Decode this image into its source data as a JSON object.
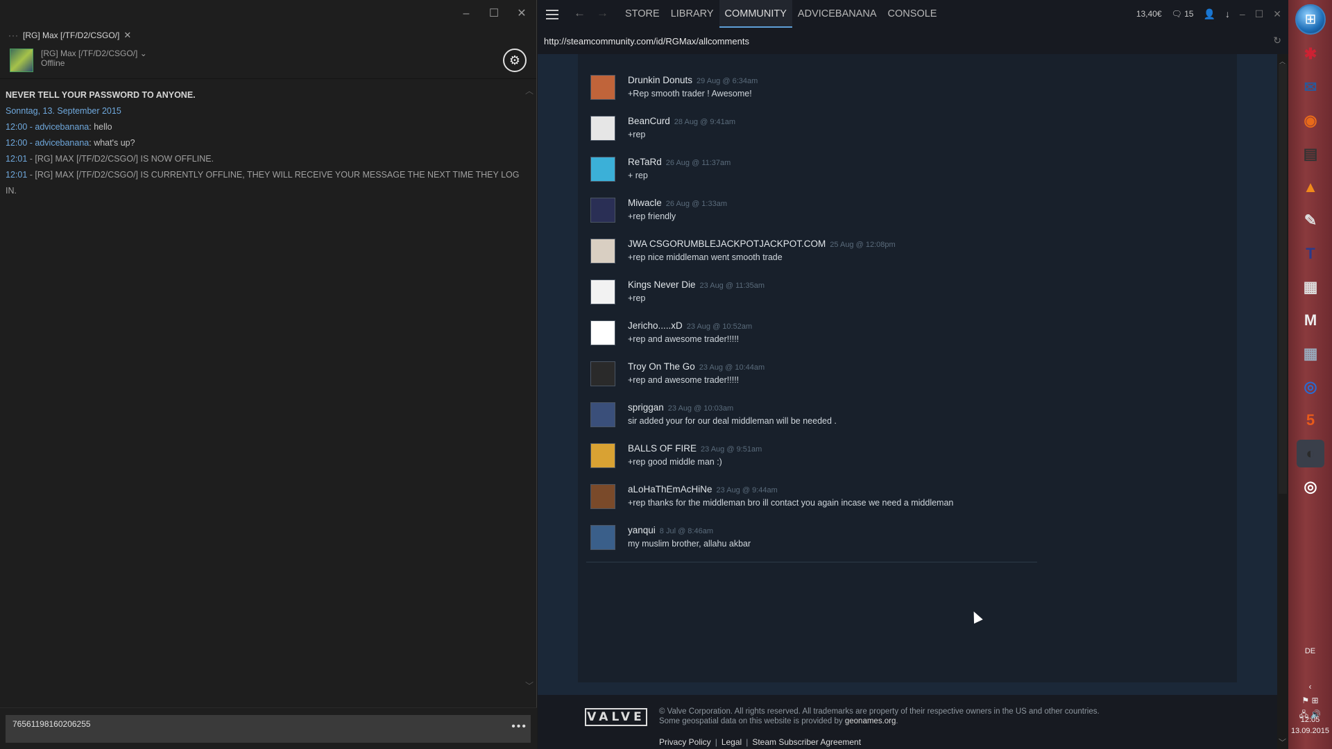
{
  "chat": {
    "tab_label": "[RG] Max [/TF/D2/CSGO/]",
    "user_name": "[RG] Max [/TF/D2/CSGO/]",
    "user_status": "Offline",
    "log": {
      "warning": "NEVER TELL YOUR PASSWORD TO ANYONE.",
      "date": "Sonntag, 13. September 2015",
      "messages": [
        {
          "time": "12:00",
          "sender": "advicebanana",
          "text": "hello"
        },
        {
          "time": "12:00",
          "sender": "advicebanana",
          "text": "what's up?"
        },
        {
          "time": "12:01",
          "system": "[RG] MAX [/TF/D2/CSGO/] IS NOW OFFLINE."
        },
        {
          "time": "12:01",
          "system": "[RG] MAX [/TF/D2/CSGO/] IS CURRENTLY OFFLINE, THEY WILL RECEIVE YOUR MESSAGE THE NEXT TIME THEY LOG IN."
        }
      ]
    },
    "input_value": "76561198160206255"
  },
  "steam": {
    "nav": [
      "STORE",
      "LIBRARY",
      "COMMUNITY",
      "ADVICEBANANA",
      "CONSOLE"
    ],
    "active_nav": "COMMUNITY",
    "wallet": "13,40€",
    "notifications": "15",
    "url": "http://steamcommunity.com/id/RGMax/allcomments",
    "comments": [
      {
        "author": "Drunkin Donuts",
        "time": "29 Aug @ 6:34am",
        "text": "+Rep smooth trader ! Awesome!",
        "avatar_color": "#c0643a"
      },
      {
        "author": "BeanCurd",
        "time": "28 Aug @ 9:41am",
        "text": "+rep",
        "avatar_color": "#e6e6e6"
      },
      {
        "author": "ReTaRd",
        "time": "26 Aug @ 11:37am",
        "text": "+ rep",
        "avatar_color": "#3bb0d8"
      },
      {
        "author": "Miwacle",
        "time": "26 Aug @ 1:33am",
        "text": "+rep friendly",
        "avatar_color": "#2a2f55"
      },
      {
        "author": "JWA CSGORUMBLEJACKPOTJACKPOT.COM",
        "time": "25 Aug @ 12:08pm",
        "text": "+rep nice middleman went smooth trade",
        "avatar_color": "#d9cfc2"
      },
      {
        "author": "Kings Never Die",
        "time": "23 Aug @ 11:35am",
        "text": "+rep",
        "avatar_color": "#f2f2f2"
      },
      {
        "author": "Jericho.....xD",
        "time": "23 Aug @ 10:52am",
        "text": "+rep and awesome trader!!!!!",
        "avatar_color": "#ffffff"
      },
      {
        "author": "Troy On The Go",
        "time": "23 Aug @ 10:44am",
        "text": "+rep and awesome trader!!!!!",
        "avatar_color": "#2a2a2a"
      },
      {
        "author": "spriggan",
        "time": "23 Aug @ 10:03am",
        "text": "sir added your for our deal middleman will be needed .",
        "avatar_color": "#3a4f7a"
      },
      {
        "author": "BALLS OF FIRE",
        "time": "23 Aug @ 9:51am",
        "text": "+rep good middle man :)",
        "avatar_color": "#d9a233"
      },
      {
        "author": "aLoHaThEmAcHiNe",
        "time": "23 Aug @ 9:44am",
        "text": "+rep thanks for the middleman bro ill contact you again incase we need a middleman",
        "avatar_color": "#7a4a2a"
      },
      {
        "author": "yanqui",
        "time": "8 Jul @ 8:46am",
        "text": "my muslim brother, allahu akbar",
        "avatar_color": "#3a5f8a"
      }
    ],
    "footer": {
      "logo": "VALVE",
      "line1": "© Valve Corporation. All rights reserved. All trademarks are property of their respective owners in the US and other countries.",
      "line2_prefix": "Some geospatial data on this website is provided by ",
      "line2_link": "geonames.org",
      "line2_suffix": ".",
      "links": [
        "Privacy Policy",
        "Legal",
        "Steam Subscriber Agreement"
      ]
    }
  },
  "taskbar": {
    "language": "DE",
    "time": "12:05",
    "date": "13.09.2015",
    "icons": [
      "windows-start-icon",
      "red-star-icon",
      "thunderbird-icon",
      "firefox-icon",
      "terminal-icon",
      "vlc-icon",
      "notepad-icon",
      "tex-icon",
      "app-icon",
      "gmail-icon",
      "calculator-icon",
      "ubuntu-icon",
      "html5-icon",
      "steam-icon",
      "chrome-icon"
    ]
  }
}
